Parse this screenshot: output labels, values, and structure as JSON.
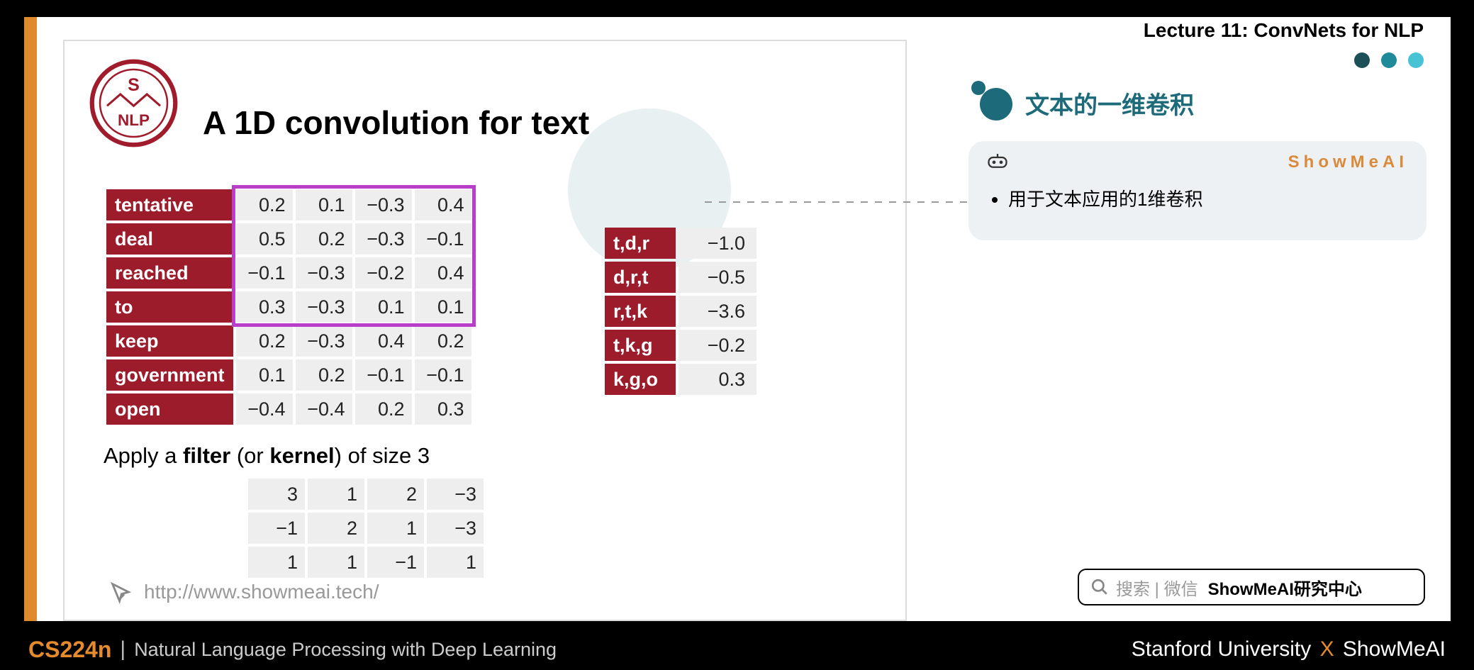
{
  "lecture_header": "Lecture 11: ConvNets for NLP",
  "slide_title": "A 1D convolution for text",
  "logo_text_top": "S",
  "logo_text_bot": "NLP",
  "word_table": {
    "rows": [
      {
        "word": "tentative",
        "v": [
          "0.2",
          "0.1",
          "−0.3",
          "0.4"
        ]
      },
      {
        "word": "deal",
        "v": [
          "0.5",
          "0.2",
          "−0.3",
          "−0.1"
        ]
      },
      {
        "word": "reached",
        "v": [
          "−0.1",
          "−0.3",
          "−0.2",
          "0.4"
        ]
      },
      {
        "word": "to",
        "v": [
          "0.3",
          "−0.3",
          "0.1",
          "0.1"
        ]
      },
      {
        "word": "keep",
        "v": [
          "0.2",
          "−0.3",
          "0.4",
          "0.2"
        ]
      },
      {
        "word": "government",
        "v": [
          "0.1",
          "0.2",
          "−0.1",
          "−0.1"
        ]
      },
      {
        "word": "open",
        "v": [
          "−0.4",
          "−0.4",
          "0.2",
          "0.3"
        ]
      }
    ]
  },
  "output_table": {
    "rows": [
      {
        "lbl": "t,d,r",
        "val": "−1.0"
      },
      {
        "lbl": "d,r,t",
        "val": "−0.5"
      },
      {
        "lbl": "r,t,k",
        "val": "−3.6"
      },
      {
        "lbl": "t,k,g",
        "val": "−0.2"
      },
      {
        "lbl": "k,g,o",
        "val": "0.3"
      }
    ]
  },
  "filter_caption_pre": "Apply a ",
  "filter_caption_b1": "filter",
  "filter_caption_mid": " (or ",
  "filter_caption_b2": "kernel",
  "filter_caption_post": ") of size 3",
  "filter_table": {
    "rows": [
      [
        "3",
        "1",
        "2",
        "−3"
      ],
      [
        "−1",
        "2",
        "1",
        "−3"
      ],
      [
        "1",
        "1",
        "−1",
        "1"
      ]
    ]
  },
  "link_text": "http://www.showmeai.tech/",
  "side_title": "文本的一维卷积",
  "note_brand": "ShowMeAI",
  "note_bullet": "用于文本应用的1维卷积",
  "search_hint": "搜索 | 微信",
  "search_strong": "ShowMeAI研究中心",
  "footer_course": "CS224n",
  "footer_sep": "|",
  "footer_sub": "Natural Language Processing with Deep Learning",
  "footer_right_a": "Stanford University",
  "footer_right_x": "X",
  "footer_right_b": "ShowMeAI",
  "dot_colors": [
    "#1d4f57",
    "#1f8a99",
    "#47c3d3"
  ],
  "chart_data": {
    "type": "table",
    "embeddings": {
      "tentative": [
        0.2,
        0.1,
        -0.3,
        0.4
      ],
      "deal": [
        0.5,
        0.2,
        -0.3,
        -0.1
      ],
      "reached": [
        -0.1,
        -0.3,
        -0.2,
        0.4
      ],
      "to": [
        0.3,
        -0.3,
        0.1,
        0.1
      ],
      "keep": [
        0.2,
        -0.3,
        0.4,
        0.2
      ],
      "government": [
        0.1,
        0.2,
        -0.1,
        -0.1
      ],
      "open": [
        -0.4,
        -0.4,
        0.2,
        0.3
      ]
    },
    "filter_size": 3,
    "filter": [
      [
        3,
        1,
        2,
        -3
      ],
      [
        -1,
        2,
        1,
        -3
      ],
      [
        1,
        1,
        -1,
        1
      ]
    ],
    "outputs": {
      "t,d,r": -1.0,
      "d,r,t": -0.5,
      "r,t,k": -3.6,
      "t,k,g": -0.2,
      "k,g,o": 0.3
    }
  }
}
